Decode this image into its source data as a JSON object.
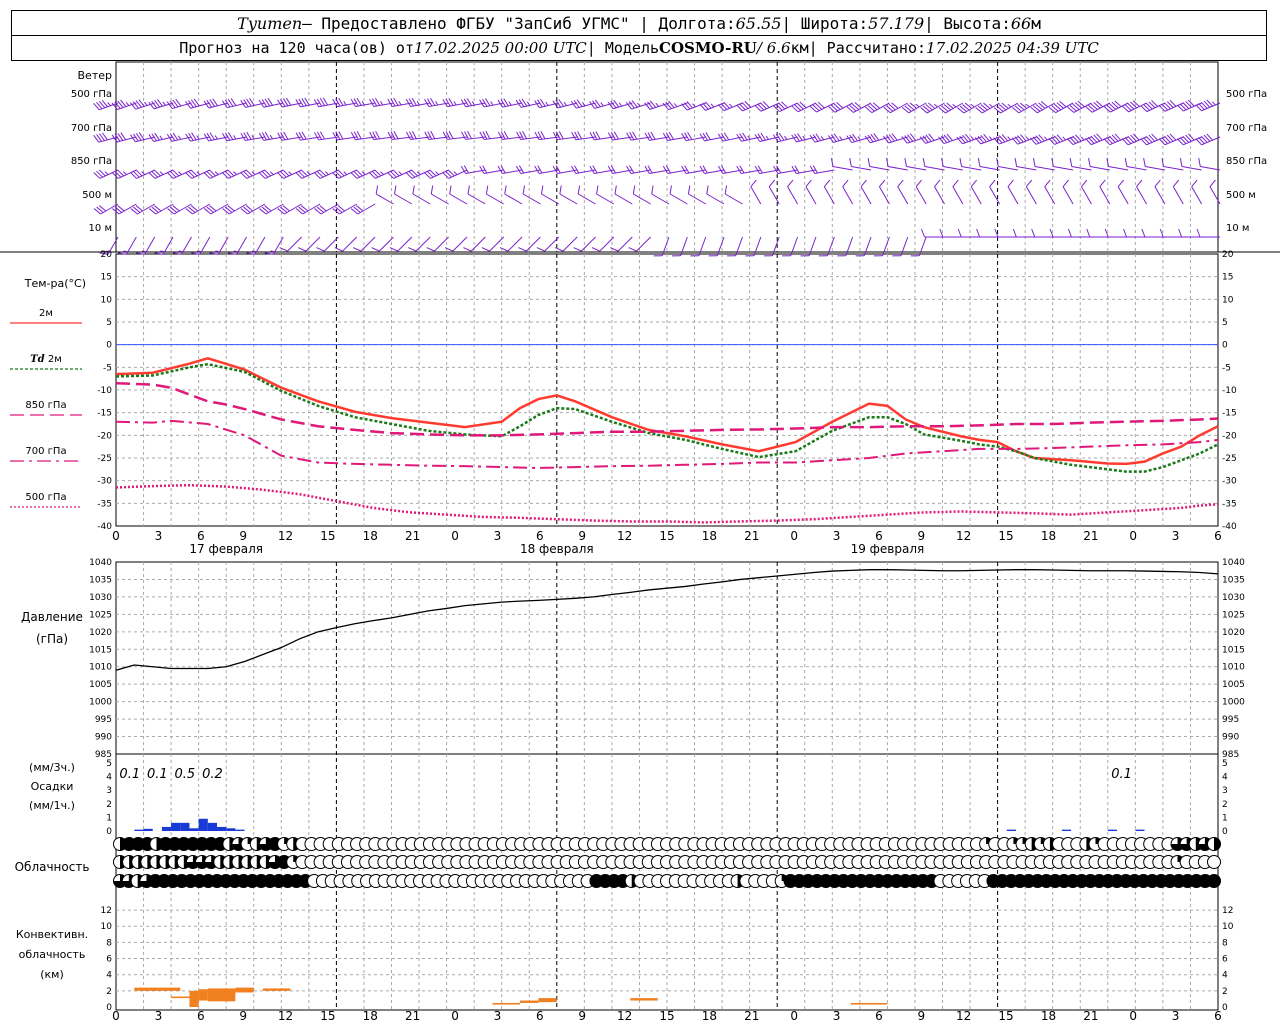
{
  "header": {
    "station": "Tyumen",
    "provider": " – Предоставлено ФГБУ \"ЗапСиб УГМС\" | Долгота: ",
    "lon": "65.55",
    "lat_label": " | Широта: ",
    "lat": "57.179",
    "alt_label": " | Высота: ",
    "alt": "66",
    "alt_unit": "м",
    "forecast_label": "Прогноз на 120 часа(ов) от ",
    "forecast_time": "17.02.2025 00:00 UTC",
    "model_label": " | Модель ",
    "model": "COSMO-RU",
    "model_res": " / 6.6",
    "model_res_unit": "км",
    "calc_label": " | Рассчитано: ",
    "calc_time": "17.02.2025 04:39 UTC"
  },
  "colors": {
    "t2m": "#ff3b30",
    "td2m": "#1a7a1a",
    "t850": "#e0187a",
    "t700": "#e0187a",
    "t500": "#e0187a",
    "wind": "#7a22cc",
    "pressure": "#000000",
    "precip": "#1a3ad6",
    "convective": "#f08020",
    "zero_line": "#3355ff",
    "grid": "#999999"
  },
  "chart_data": [
    {
      "type": "barbs",
      "panel": "wind",
      "title": "Ветер",
      "levels": [
        "500 гПа",
        "700 гПа",
        "850 гПа",
        "500 м",
        "10  м"
      ],
      "x_hours_step": 1,
      "x_range": [
        0,
        120
      ]
    },
    {
      "type": "line",
      "panel": "temperature",
      "title": "Тем-ра(°C)",
      "ylim": [
        -40,
        20
      ],
      "yticks": [
        -40,
        -35,
        -30,
        -25,
        -20,
        -15,
        -10,
        -5,
        0,
        5,
        10,
        15,
        20
      ],
      "x_ticks": [
        "0",
        "3",
        "6",
        "9",
        "12",
        "15",
        "18",
        "21",
        "0",
        "3",
        "6",
        "9",
        "12",
        "15",
        "18",
        "21",
        "0",
        "3",
        "6",
        "9",
        "12",
        "15",
        "18",
        "21",
        "0",
        "3",
        "6"
      ],
      "day_labels": [
        "17 февраля",
        "18 февраля",
        "19 февраля"
      ],
      "series": [
        {
          "name": "2м",
          "x": [
            0,
            4,
            8,
            10,
            14,
            18,
            22,
            26,
            30,
            34,
            38,
            42,
            44,
            46,
            48,
            50,
            54,
            58,
            62,
            66,
            70,
            74,
            78,
            82,
            84,
            86,
            88,
            92,
            94,
            96,
            98,
            100,
            104,
            108,
            110,
            112,
            114,
            116,
            118,
            120
          ],
          "y": [
            -6.5,
            -6.2,
            -4.2,
            -3,
            -5.5,
            -9.5,
            -12.5,
            -14.8,
            -16.2,
            -17.2,
            -18.2,
            -17,
            -14,
            -12,
            -11.2,
            -12.5,
            -16,
            -18.8,
            -20.2,
            -22,
            -23.5,
            -21.5,
            -17,
            -13,
            -13.5,
            -16.5,
            -18.2,
            -20.2,
            -21,
            -21.5,
            -23.5,
            -25,
            -25.5,
            -26.2,
            -26.3,
            -25.8,
            -24,
            -22.5,
            -20,
            -18
          ]
        },
        {
          "name": "Td 2м",
          "x": [
            0,
            4,
            8,
            10,
            14,
            18,
            22,
            26,
            30,
            34,
            38,
            42,
            44,
            46,
            48,
            50,
            54,
            58,
            62,
            66,
            70,
            74,
            78,
            82,
            84,
            86,
            88,
            92,
            94,
            96,
            98,
            100,
            104,
            108,
            110,
            112,
            114,
            116,
            118,
            120
          ],
          "y": [
            -7,
            -6.8,
            -5,
            -4.3,
            -6,
            -10.2,
            -13.5,
            -16,
            -17.5,
            -19,
            -19.8,
            -20.2,
            -18,
            -15.5,
            -14,
            -14.2,
            -17,
            -19.5,
            -21,
            -23,
            -24.8,
            -23.5,
            -19,
            -16,
            -16,
            -17.5,
            -19.8,
            -21.2,
            -22,
            -22.5,
            -23.5,
            -25,
            -26.5,
            -27.5,
            -28,
            -28,
            -27,
            -25.5,
            -24,
            -22
          ]
        },
        {
          "name": "850 гПа",
          "x": [
            0,
            4,
            6,
            10,
            12,
            14,
            18,
            22,
            26,
            30,
            34,
            38,
            42,
            46,
            50,
            54,
            58,
            62,
            66,
            70,
            74,
            78,
            82,
            86,
            90,
            94,
            98,
            102,
            106,
            110,
            114,
            118,
            120
          ],
          "y": [
            -8.5,
            -8.8,
            -9.5,
            -12.5,
            -13.2,
            -14.2,
            -16.5,
            -18,
            -18.8,
            -19.5,
            -19.8,
            -20,
            -20,
            -19.8,
            -19.5,
            -19.2,
            -19.2,
            -19,
            -18.8,
            -18.7,
            -18.5,
            -18.2,
            -18.2,
            -18,
            -18,
            -17.8,
            -17.5,
            -17.5,
            -17.2,
            -17,
            -16.8,
            -16.5,
            -16.3
          ]
        },
        {
          "name": "700 гПа",
          "x": [
            0,
            4,
            6,
            10,
            14,
            18,
            22,
            26,
            30,
            34,
            38,
            42,
            46,
            50,
            54,
            58,
            62,
            66,
            70,
            74,
            78,
            82,
            86,
            90,
            94,
            98,
            102,
            106,
            110,
            114,
            118,
            120
          ],
          "y": [
            -17,
            -17.2,
            -16.8,
            -17.5,
            -20,
            -24.5,
            -26,
            -26.3,
            -26.5,
            -26.7,
            -26.8,
            -27,
            -27.2,
            -27,
            -26.8,
            -26.7,
            -26.5,
            -26.3,
            -26,
            -26,
            -25.5,
            -25,
            -24,
            -23.5,
            -23,
            -23,
            -22.8,
            -22.5,
            -22.2,
            -22,
            -21.5,
            -21
          ]
        },
        {
          "name": "500 гПа",
          "x": [
            0,
            4,
            8,
            12,
            16,
            20,
            24,
            28,
            32,
            36,
            40,
            44,
            48,
            52,
            56,
            60,
            64,
            68,
            72,
            76,
            80,
            84,
            88,
            92,
            96,
            100,
            104,
            108,
            112,
            116,
            118,
            120
          ],
          "y": [
            -31.5,
            -31.2,
            -31,
            -31.3,
            -32,
            -33,
            -34.5,
            -36,
            -37,
            -37.5,
            -38,
            -38.2,
            -38.5,
            -38.8,
            -39,
            -39,
            -39.2,
            -39,
            -38.8,
            -38.5,
            -38,
            -37.5,
            -37,
            -36.8,
            -37,
            -37.2,
            -37.5,
            -37,
            -36.5,
            -36,
            -35.5,
            -35.2
          ]
        }
      ]
    },
    {
      "type": "line",
      "panel": "pressure",
      "title": "Давление",
      "ylabel": "(гПа)",
      "ylim": [
        985,
        1040
      ],
      "yticks": [
        985,
        990,
        995,
        1000,
        1005,
        1010,
        1015,
        1020,
        1025,
        1030,
        1035,
        1040
      ],
      "series": [
        {
          "x": [
            0,
            2,
            4,
            6,
            8,
            10,
            12,
            14,
            16,
            18,
            20,
            22,
            24,
            26,
            28,
            30,
            32,
            34,
            36,
            38,
            40,
            42,
            44,
            46,
            48,
            50,
            52,
            54,
            56,
            58,
            60,
            62,
            64,
            66,
            68,
            70,
            72,
            74,
            76,
            78,
            80,
            82,
            84,
            86,
            88,
            90,
            92,
            94,
            96,
            98,
            100,
            102,
            104,
            106,
            108,
            110,
            112,
            114,
            116,
            118,
            120
          ],
          "y": [
            1009,
            1010.5,
            1010,
            1009.5,
            1009.5,
            1009.5,
            1010,
            1011.5,
            1013.5,
            1015.5,
            1018,
            1020,
            1021.2,
            1022.3,
            1023.2,
            1024,
            1025,
            1026,
            1026.7,
            1027.5,
            1028,
            1028.5,
            1028.8,
            1029,
            1029.3,
            1029.6,
            1030,
            1030.7,
            1031.3,
            1032,
            1032.5,
            1033,
            1033.7,
            1034.3,
            1035,
            1035.5,
            1036,
            1036.5,
            1037,
            1037.4,
            1037.6,
            1037.8,
            1037.8,
            1037.7,
            1037.6,
            1037.5,
            1037.5,
            1037.6,
            1037.7,
            1037.8,
            1037.8,
            1037.7,
            1037.6,
            1037.5,
            1037.5,
            1037.5,
            1037.4,
            1037.3,
            1037.2,
            1037,
            1036.6
          ]
        }
      ]
    },
    {
      "type": "bar",
      "panel": "precipitation",
      "title": "Осадки",
      "ylabel_top": "(мм/3ч.)",
      "ylabel_bottom": "(мм/1ч.)",
      "ylim": [
        0,
        5
      ],
      "sums_3h": [
        {
          "hour": 1.5,
          "value": "0.1"
        },
        {
          "hour": 4.5,
          "value": "0.1"
        },
        {
          "hour": 7.5,
          "value": "0.5"
        },
        {
          "hour": 10.5,
          "value": "0.2"
        },
        {
          "hour": 109.5,
          "value": "0.1"
        }
      ],
      "hourly": [
        {
          "x": [
            2,
            3
          ],
          "v": 0.05
        },
        {
          "x": [
            3,
            4
          ],
          "v": 0.08
        },
        {
          "x": [
            5,
            6
          ],
          "v": 0.15
        },
        {
          "x": [
            6,
            7
          ],
          "v": 0.3
        },
        {
          "x": [
            7,
            8
          ],
          "v": 0.3
        },
        {
          "x": [
            8,
            9
          ],
          "v": 0.1
        },
        {
          "x": [
            9,
            10
          ],
          "v": 0.45
        },
        {
          "x": [
            10,
            11
          ],
          "v": 0.3
        },
        {
          "x": [
            11,
            12
          ],
          "v": 0.15
        },
        {
          "x": [
            12,
            13
          ],
          "v": 0.1
        },
        {
          "x": [
            13,
            14
          ],
          "v": 0.05
        },
        {
          "x": [
            97,
            98
          ],
          "v": 0.05
        },
        {
          "x": [
            103,
            104
          ],
          "v": 0.05
        },
        {
          "x": [
            108,
            109
          ],
          "v": 0.05
        },
        {
          "x": [
            111,
            112
          ],
          "v": 0.05
        }
      ]
    },
    {
      "type": "table",
      "panel": "cloudiness",
      "title": "Облачность",
      "rows": 3,
      "x_range": [
        0,
        120
      ],
      "cover_scale": "0=clear,1=quarter,2=half,3=three-quarter,4=overcast",
      "high": [
        2,
        4,
        4,
        4,
        2,
        4,
        4,
        4,
        4,
        4,
        4,
        4,
        2,
        3,
        1,
        2,
        3,
        4,
        1,
        2,
        0,
        0,
        0,
        0,
        0,
        0,
        0,
        0,
        0,
        0,
        0,
        0,
        0,
        0,
        0,
        0,
        0,
        0,
        0,
        0,
        0,
        0,
        0,
        0,
        0,
        0,
        0,
        0,
        0,
        0,
        0,
        0,
        0,
        0,
        0,
        0,
        0,
        0,
        0,
        0,
        0,
        0,
        0,
        0,
        0,
        0,
        0,
        0,
        0,
        0,
        0,
        0,
        0,
        0,
        0,
        0,
        0,
        0,
        0,
        0,
        0,
        0,
        0,
        0,
        0,
        0,
        0,
        0,
        0,
        0,
        0,
        0,
        0,
        0,
        0,
        1,
        0,
        0,
        1,
        1,
        2,
        1,
        2,
        0,
        0,
        0,
        2,
        1,
        0,
        0,
        0,
        0,
        0,
        0,
        0,
        0,
        3,
        3,
        2,
        3,
        2
      ],
      "mid": [
        2,
        2,
        2,
        2,
        2,
        2,
        2,
        2,
        3,
        3,
        3,
        2,
        2,
        2,
        2,
        2,
        2,
        3,
        4,
        1,
        0,
        0,
        0,
        0,
        0,
        0,
        0,
        0,
        0,
        0,
        0,
        0,
        0,
        0,
        0,
        0,
        0,
        0,
        0,
        0,
        0,
        0,
        0,
        0,
        0,
        0,
        0,
        0,
        0,
        0,
        0,
        0,
        0,
        0,
        0,
        0,
        0,
        0,
        0,
        0,
        0,
        0,
        0,
        0,
        0,
        0,
        0,
        0,
        0,
        0,
        0,
        0,
        0,
        0,
        0,
        0,
        0,
        0,
        0,
        0,
        0,
        0,
        0,
        0,
        0,
        0,
        0,
        0,
        0,
        0,
        0,
        0,
        0,
        0,
        0,
        0,
        0,
        0,
        0,
        0,
        0,
        0,
        0,
        0,
        0,
        0,
        0,
        0,
        0,
        0,
        0,
        0,
        0,
        0,
        0,
        0,
        1,
        0,
        0,
        0,
        0
      ],
      "low": [
        3,
        3,
        2,
        3,
        4,
        4,
        4,
        4,
        4,
        4,
        4,
        4,
        4,
        4,
        4,
        4,
        4,
        4,
        4,
        4,
        4,
        4,
        0,
        0,
        0,
        0,
        0,
        0,
        0,
        0,
        0,
        0,
        0,
        0,
        0,
        0,
        0,
        0,
        0,
        0,
        0,
        0,
        0,
        0,
        0,
        0,
        0,
        0,
        0,
        0,
        0,
        0,
        0,
        0,
        4,
        4,
        4,
        4,
        2,
        0,
        0,
        0,
        0,
        0,
        0,
        0,
        0,
        0,
        0,
        0,
        2,
        0,
        0,
        0,
        0,
        1,
        4,
        4,
        4,
        4,
        4,
        4,
        4,
        4,
        4,
        4,
        4,
        4,
        4,
        4,
        4,
        4,
        4,
        0,
        0,
        0,
        0,
        0,
        0,
        4,
        4,
        4,
        4,
        4,
        4,
        4,
        4,
        4,
        4,
        4,
        4,
        4,
        4,
        4,
        4,
        4,
        4,
        4,
        4,
        4,
        4,
        4,
        4,
        4,
        4
      ]
    },
    {
      "type": "bar",
      "panel": "convective",
      "title_lines": [
        "Конвективн.",
        "облачность",
        "(км)"
      ],
      "ylim": [
        0,
        13
      ],
      "yticks": [
        0,
        2,
        4,
        6,
        8,
        10,
        12
      ],
      "segments": [
        {
          "x": [
            2,
            7
          ],
          "base": 2,
          "top": 2.4
        },
        {
          "x": [
            6,
            8
          ],
          "base": 1.1,
          "top": 1.3
        },
        {
          "x": [
            8,
            9
          ],
          "base": 0,
          "top": 2
        },
        {
          "x": [
            9,
            10
          ],
          "base": 0.8,
          "top": 2.2
        },
        {
          "x": [
            10,
            13
          ],
          "base": 0.7,
          "top": 2.3
        },
        {
          "x": [
            13,
            15
          ],
          "base": 1.8,
          "top": 2.4
        },
        {
          "x": [
            16,
            19
          ],
          "base": 2,
          "top": 2.3
        },
        {
          "x": [
            41,
            44
          ],
          "base": 0.3,
          "top": 0.5
        },
        {
          "x": [
            44,
            46
          ],
          "base": 0.5,
          "top": 0.8
        },
        {
          "x": [
            46,
            48
          ],
          "base": 0.6,
          "top": 1.1
        },
        {
          "x": [
            56,
            59
          ],
          "base": 0.8,
          "top": 1.1
        },
        {
          "x": [
            80,
            84
          ],
          "base": 0.3,
          "top": 0.5
        }
      ]
    }
  ],
  "labels": {
    "wind_title": "Ветер",
    "temp_title": "Тем-ра(°C)",
    "legend_2m": "2м",
    "legend_td": "Td",
    "legend_td_2m": " 2м",
    "legend_850": "850 гПа",
    "legend_700": "700 гПа",
    "legend_500": "500 гПа",
    "pressure_title": "Давление",
    "pressure_unit": "(гПа)",
    "precip_top": "(мм/3ч.)",
    "precip_title": "Осадки",
    "precip_bottom": "(мм/1ч.)",
    "cloud_title": "Облачность",
    "conv_1": "Конвективн.",
    "conv_2": "облачность",
    "conv_3": "(км)"
  }
}
